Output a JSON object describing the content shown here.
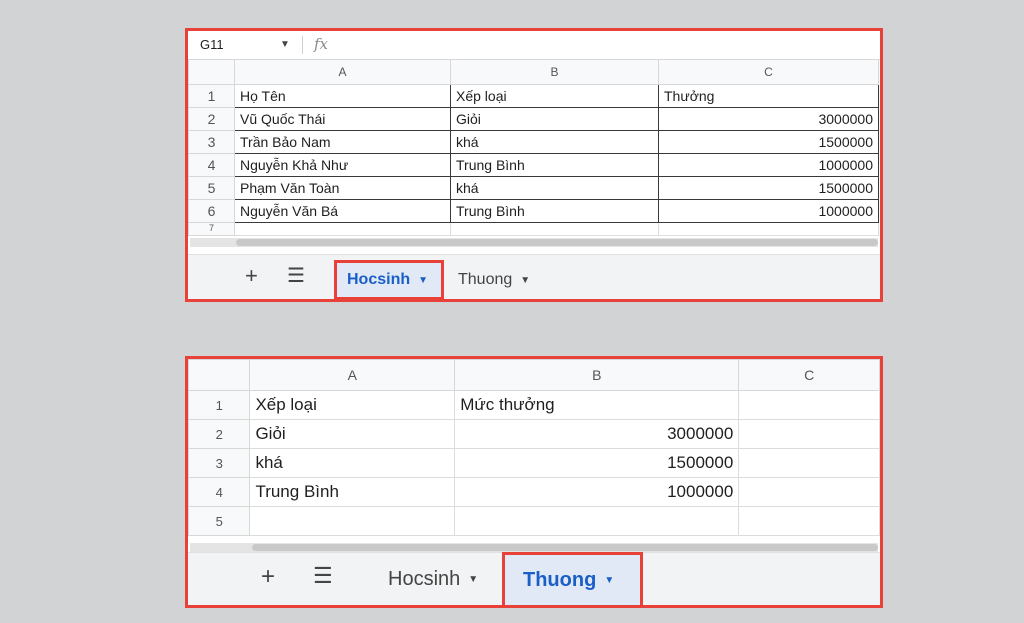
{
  "sheet1": {
    "name_box": "G11",
    "fx_label": "fx",
    "columns": [
      "A",
      "B",
      "C"
    ],
    "rows": [
      {
        "n": "1",
        "a": "Họ Tên",
        "b": "Xếp loại",
        "c": "Thưởng"
      },
      {
        "n": "2",
        "a": "Vũ Quốc Thái",
        "b": "Giỏi",
        "c": "3000000"
      },
      {
        "n": "3",
        "a": "Trần Bảo Nam",
        "b": "khá",
        "c": "1500000"
      },
      {
        "n": "4",
        "a": "Nguyễn Khả Như",
        "b": "Trung Bình",
        "c": "1000000"
      },
      {
        "n": "5",
        "a": "Phạm Văn Toàn",
        "b": "khá",
        "c": "1500000"
      },
      {
        "n": "6",
        "a": "Nguyễn Văn Bá",
        "b": "Trung Bình",
        "c": "1000000"
      }
    ],
    "row7": "7",
    "tabs": [
      "Hocsinh",
      "Thuong"
    ],
    "active_tab": "Hocsinh"
  },
  "sheet2": {
    "columns": [
      "A",
      "B",
      "C"
    ],
    "rows": [
      {
        "n": "1",
        "a": "Xếp loại",
        "b": "Mức thưởng"
      },
      {
        "n": "2",
        "a": "Giỏi",
        "b": "3000000"
      },
      {
        "n": "3",
        "a": "khá",
        "b": "1500000"
      },
      {
        "n": "4",
        "a": "Trung Bình",
        "b": "1000000"
      },
      {
        "n": "5",
        "a": "",
        "b": ""
      }
    ],
    "tabs": [
      "Hocsinh",
      "Thuong"
    ],
    "active_tab": "Thuong"
  },
  "icons": {
    "add": "plus-icon",
    "menu": "hamburger-menu-icon",
    "caret": "caret-down-icon"
  },
  "colors": {
    "highlight_border": "#e8413a",
    "active_tab_text": "#1a5fc8",
    "active_tab_bg": "#e1e9f7",
    "page_bg": "#d2d3d5"
  }
}
